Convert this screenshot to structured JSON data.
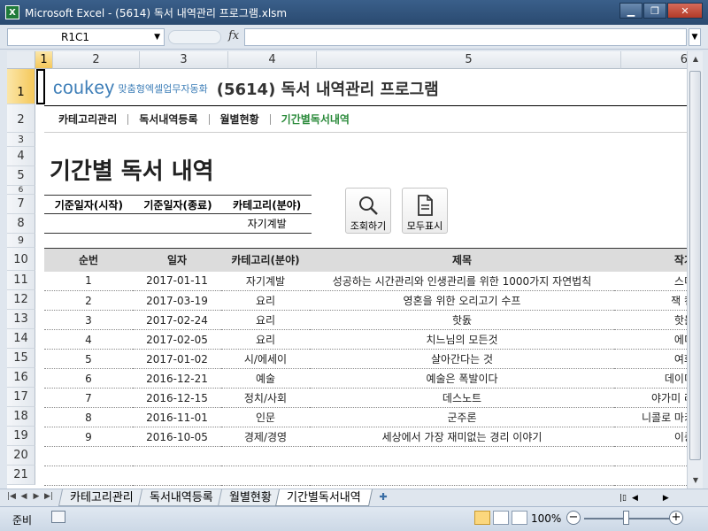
{
  "window": {
    "title": "Microsoft Excel - (5614) 독서 내역관리 프로그램.xlsm",
    "app_icon": "X",
    "controls": {
      "minimize": "▁",
      "restore": "❐",
      "close": "✕"
    }
  },
  "formula_bar": {
    "name_box": "R1C1",
    "fx_label": "fx",
    "formula": ""
  },
  "grid": {
    "columns": [
      "1",
      "2",
      "3",
      "4",
      "5",
      "6"
    ],
    "rows": [
      "1",
      "2",
      "3",
      "4",
      "5",
      "6",
      "7",
      "8",
      "9",
      "10",
      "11",
      "12",
      "13",
      "14",
      "15",
      "16",
      "17",
      "18",
      "19",
      "20",
      "21"
    ],
    "selected_cell": "R1C1"
  },
  "header": {
    "brand": "coukey",
    "brand_sub": "맞춤형엑셀업무자동화",
    "program_title": "(5614) 독서 내역관리 프로그램"
  },
  "menu": {
    "items": [
      {
        "label": "카테고리관리",
        "active": false
      },
      {
        "label": "독서내역등록",
        "active": false
      },
      {
        "label": "월별현황",
        "active": false
      },
      {
        "label": "기간별독서내역",
        "active": true
      }
    ]
  },
  "page": {
    "title": "기간별 독서 내역"
  },
  "criteria": {
    "headers": [
      "기준일자(시작)",
      "기준일자(종료)",
      "카테고리(분야)"
    ],
    "values": [
      "",
      "",
      "자기계발"
    ]
  },
  "buttons": {
    "search": "조회하기",
    "show_all": "모두표시"
  },
  "table": {
    "headers": [
      "순번",
      "일자",
      "카테고리(분야)",
      "제목",
      "작가"
    ],
    "rows": [
      [
        "1",
        "2017-01-11",
        "자기계발",
        "성공하는 시간관리와 인생관리를 위한 1000가지 자연법칙",
        "스미"
      ],
      [
        "2",
        "2017-03-19",
        "요리",
        "영혼을 위한 오리고기 수프",
        "잭 캔"
      ],
      [
        "3",
        "2017-02-24",
        "요리",
        "핫돐",
        "핫돐"
      ],
      [
        "4",
        "2017-02-05",
        "요리",
        "치느님의 모든것",
        "에디"
      ],
      [
        "5",
        "2017-01-02",
        "시/에세이",
        "살아간다는 것",
        "여화"
      ],
      [
        "6",
        "2016-12-21",
        "예술",
        "예술은 폭발이다",
        "데이미"
      ],
      [
        "7",
        "2016-12-15",
        "정치/사회",
        "데스노트",
        "야가미 라"
      ],
      [
        "8",
        "2016-11-01",
        "인문",
        "군주론",
        "니콜로 마키"
      ],
      [
        "9",
        "2016-10-05",
        "경제/경영",
        "세상에서 가장 재미없는 경리 이야기",
        "이종"
      ]
    ]
  },
  "sheet_tabs": {
    "tabs": [
      {
        "label": "카테고리관리",
        "active": false
      },
      {
        "label": "독서내역등록",
        "active": false
      },
      {
        "label": "월별현황",
        "active": false
      },
      {
        "label": "기간별독서내역",
        "active": true
      }
    ]
  },
  "status_bar": {
    "ready": "준비",
    "zoom": "100%",
    "zoom_minus": "−",
    "zoom_plus": "+"
  }
}
